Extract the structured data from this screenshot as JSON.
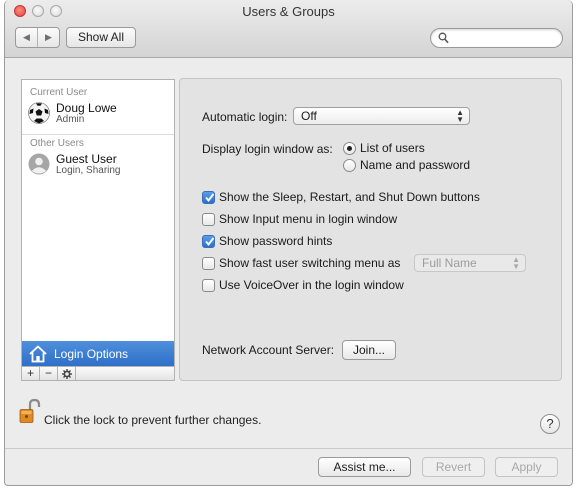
{
  "window": {
    "title": "Users & Groups"
  },
  "toolbar": {
    "show_all_label": "Show All",
    "search_placeholder": ""
  },
  "sidebar": {
    "current_user_header": "Current User",
    "current_user": {
      "name": "Doug Lowe",
      "role": "Admin"
    },
    "other_users_header": "Other Users",
    "guest_user": {
      "name": "Guest User",
      "role": "Login, Sharing"
    },
    "login_options_label": "Login Options",
    "add_label": "+",
    "remove_label": "−"
  },
  "main": {
    "automatic_login_label": "Automatic login:",
    "automatic_login_value": "Off",
    "display_login_label": "Display login window as:",
    "radio_options": [
      "List of users",
      "Name and password"
    ],
    "radio_selected": 0,
    "checkboxes": [
      {
        "label": "Show the Sleep, Restart, and Shut Down buttons",
        "checked": true
      },
      {
        "label": "Show Input menu in login window",
        "checked": false
      },
      {
        "label": "Show password hints",
        "checked": true
      },
      {
        "label": "Show fast user switching menu as",
        "checked": false
      },
      {
        "label": "Use VoiceOver in the login window",
        "checked": false
      }
    ],
    "fast_switch_value": "Full Name",
    "network_server_label": "Network Account Server:",
    "join_label": "Join..."
  },
  "footer": {
    "lock_text": "Click the lock to prevent further changes.",
    "help_label": "?",
    "assist_label": "Assist me...",
    "revert_label": "Revert",
    "apply_label": "Apply"
  },
  "colors": {
    "selection": "#2d6ec7",
    "checkbox_on": "#2a6fd0",
    "close_button": "#e0443c"
  }
}
